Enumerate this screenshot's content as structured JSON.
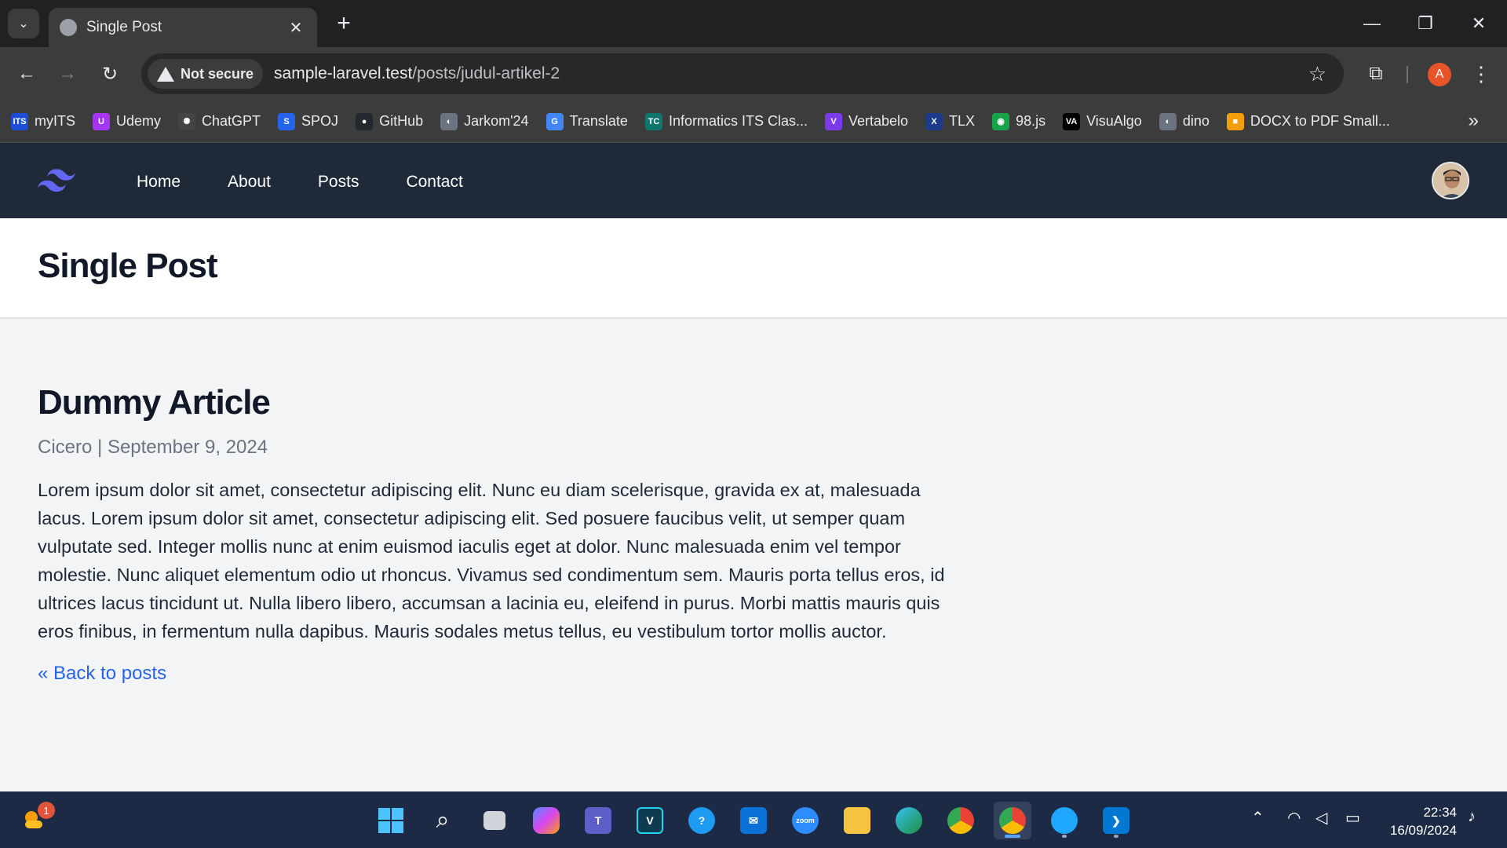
{
  "browser": {
    "tab_title": "Single Post",
    "security_label": "Not secure",
    "url_host": "sample-laravel.test",
    "url_path": "/posts/judul-artikel-2",
    "profile_initial": "A",
    "bookmarks": [
      {
        "label": "myITS",
        "icon": "ITS",
        "color": "#1d4ed8"
      },
      {
        "label": "Udemy",
        "icon": "U",
        "color": "#a435f0"
      },
      {
        "label": "ChatGPT",
        "icon": "✺",
        "color": "#444444"
      },
      {
        "label": "SPOJ",
        "icon": "S",
        "color": "#2563eb"
      },
      {
        "label": "GitHub",
        "icon": "●",
        "color": "#24292f"
      },
      {
        "label": "Jarkom'24",
        "icon": "◐",
        "color": "#6b7280"
      },
      {
        "label": "Translate",
        "icon": "G",
        "color": "#4285f4"
      },
      {
        "label": "Informatics ITS Clas...",
        "icon": "TC",
        "color": "#0f766e"
      },
      {
        "label": "Vertabelo",
        "icon": "V",
        "color": "#7c3aed"
      },
      {
        "label": "TLX",
        "icon": "X",
        "color": "#1e3a8a"
      },
      {
        "label": "98.js",
        "icon": "◉",
        "color": "#16a34a"
      },
      {
        "label": "VisuAlgo",
        "icon": "VA",
        "color": "#000000"
      },
      {
        "label": "dino",
        "icon": "◐",
        "color": "#6b7280"
      },
      {
        "label": "DOCX to PDF Small...",
        "icon": "■",
        "color": "#f59e0b"
      }
    ]
  },
  "site": {
    "nav_links": [
      "Home",
      "About",
      "Posts",
      "Contact"
    ],
    "page_title": "Single Post"
  },
  "article": {
    "title": "Dummy Article",
    "author": "Cicero",
    "separator": "|",
    "date": "September 9, 2024",
    "body": "Lorem ipsum dolor sit amet, consectetur adipiscing elit. Nunc eu diam scelerisque, gravida ex at, malesuada lacus. Lorem ipsum dolor sit amet, consectetur adipiscing elit. Sed posuere faucibus velit, ut semper quam vulputate sed. Integer mollis nunc at enim euismod iaculis eget at dolor. Nunc malesuada enim vel tempor molestie. Nunc aliquet elementum odio ut rhoncus. Vivamus sed condimentum sem. Mauris porta tellus eros, id ultrices lacus tincidunt ut. Nulla libero libero, accumsan a lacinia eu, eleifend in purus. Morbi mattis mauris quis eros finibus, in fermentum nulla dapibus. Mauris sodales metus tellus, eu vestibulum tortor mollis auctor.",
    "back_link": "« Back to posts"
  },
  "taskbar": {
    "weather_badge": "1",
    "time": "22:34",
    "date": "16/09/2024"
  },
  "colors": {
    "nav_bg": "#1f2937",
    "link_blue": "#2563eb",
    "page_bg": "#f3f4f6"
  }
}
